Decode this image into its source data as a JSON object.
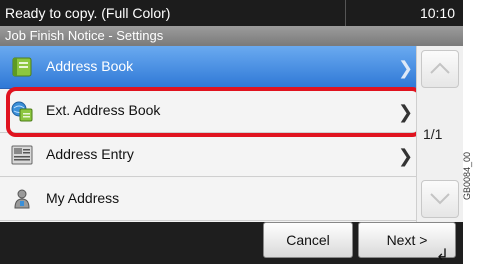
{
  "status": {
    "text": "Ready to copy. (Full Color)",
    "time": "10:10"
  },
  "subtitle": "Job Finish Notice - Settings",
  "items": [
    {
      "label": "Address Book",
      "icon": "address-book-icon"
    },
    {
      "label": "Ext. Address Book",
      "icon": "ext-address-book-icon"
    },
    {
      "label": "Address Entry",
      "icon": "address-entry-icon"
    },
    {
      "label": "My Address",
      "icon": "my-address-icon"
    }
  ],
  "page_indicator": "1/1",
  "buttons": {
    "cancel": "Cancel",
    "next": "Next >"
  },
  "side_code": "GB0084_00",
  "colors": {
    "selected": "#3c86e0",
    "highlight": "#e0131f",
    "status_bg": "#1c1c1c"
  }
}
